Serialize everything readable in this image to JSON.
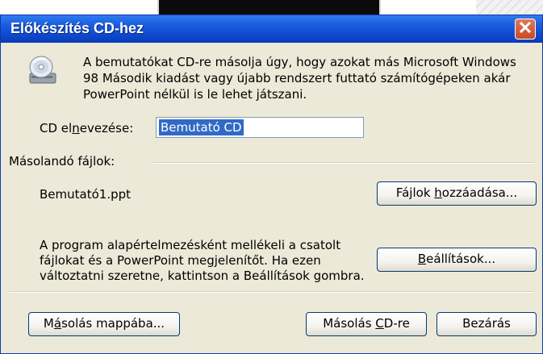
{
  "window": {
    "title": "Előkészítés CD-hez",
    "close_symbol": "✕"
  },
  "intro_text": "A bemutatókat CD-re másolja úgy, hogy azokat más Microsoft Windows 98 Második kiadást vagy újabb rendszert futtató számítógépeken akár PowerPoint nélkül is le lehet játszani.",
  "cd_name": {
    "label_pre": "CD el",
    "label_mnemonic": "n",
    "label_post": "evezése:",
    "value": "Bemutató CD"
  },
  "files_section": {
    "header": "Másolandó fájlok:",
    "file": "Bemutató1.ppt",
    "add_button": {
      "pre": "Fájlok ",
      "mnemonic": "h",
      "post": "ozzáadása..."
    }
  },
  "description": "A program alapértelmezésként mellékeli a csatolt fájlokat és a PowerPoint megjelenítőt. Ha ezen változtatni szeretne, kattintson a Beállítások gombra.",
  "options_button": {
    "pre": "",
    "mnemonic": "B",
    "post": "eállítások..."
  },
  "footer": {
    "copy_folder": {
      "pre": "M",
      "mnemonic": "á",
      "post": "solás mappába..."
    },
    "copy_cd": {
      "pre": "Másolás ",
      "mnemonic": "C",
      "post": "D-re"
    },
    "close": {
      "pre": "Bezárás",
      "mnemonic": "",
      "post": ""
    }
  },
  "icons": [
    "cd-drive-icon",
    "close-icon"
  ],
  "colors": {
    "titlebar": "#0f4ad0",
    "dialog_bg": "#ece9d8",
    "selection": "#316ac5",
    "close_button": "#c84a23"
  }
}
